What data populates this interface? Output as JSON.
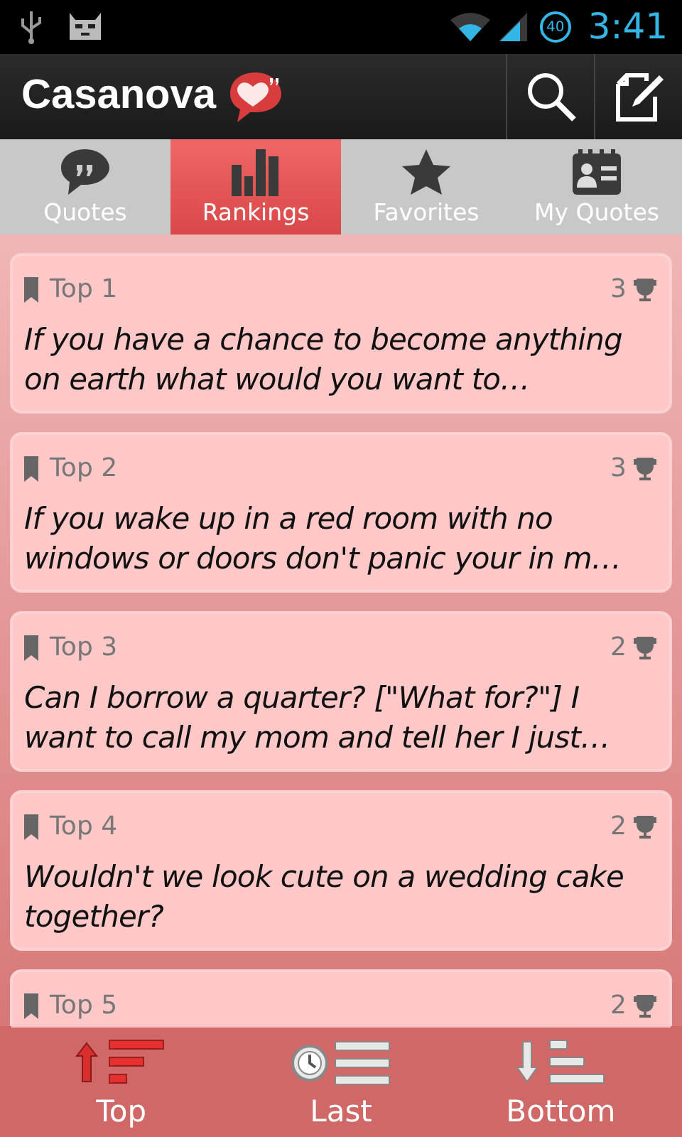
{
  "status_bar": {
    "battery": "40",
    "time": "3:41"
  },
  "action_bar": {
    "title": "Casanova"
  },
  "tabs": [
    {
      "label": "Quotes",
      "kind": "quote",
      "selected": false
    },
    {
      "label": "Rankings",
      "kind": "chart",
      "selected": true
    },
    {
      "label": "Favorites",
      "kind": "star",
      "selected": false
    },
    {
      "label": "My Quotes",
      "kind": "contact",
      "selected": false
    }
  ],
  "quotes": [
    {
      "rank": "Top 1",
      "votes": "3",
      "text": "If you have a chance to become anything on earth what would you want to…"
    },
    {
      "rank": "Top 2",
      "votes": "3",
      "text": "If you wake up in a red room with no windows or doors don't panic your in m…"
    },
    {
      "rank": "Top 3",
      "votes": "2",
      "text": "Can I borrow a quarter? [\"What for?\"] I want to call my mom and tell her I just…"
    },
    {
      "rank": "Top 4",
      "votes": "2",
      "text": "Wouldn't we look cute on a wedding cake together?"
    },
    {
      "rank": "Top 5",
      "votes": "2"
    }
  ],
  "bottom_bar": [
    {
      "label": "Top",
      "kind": "top"
    },
    {
      "label": "Last",
      "kind": "last"
    },
    {
      "label": "Bottom",
      "kind": "bottom"
    }
  ]
}
